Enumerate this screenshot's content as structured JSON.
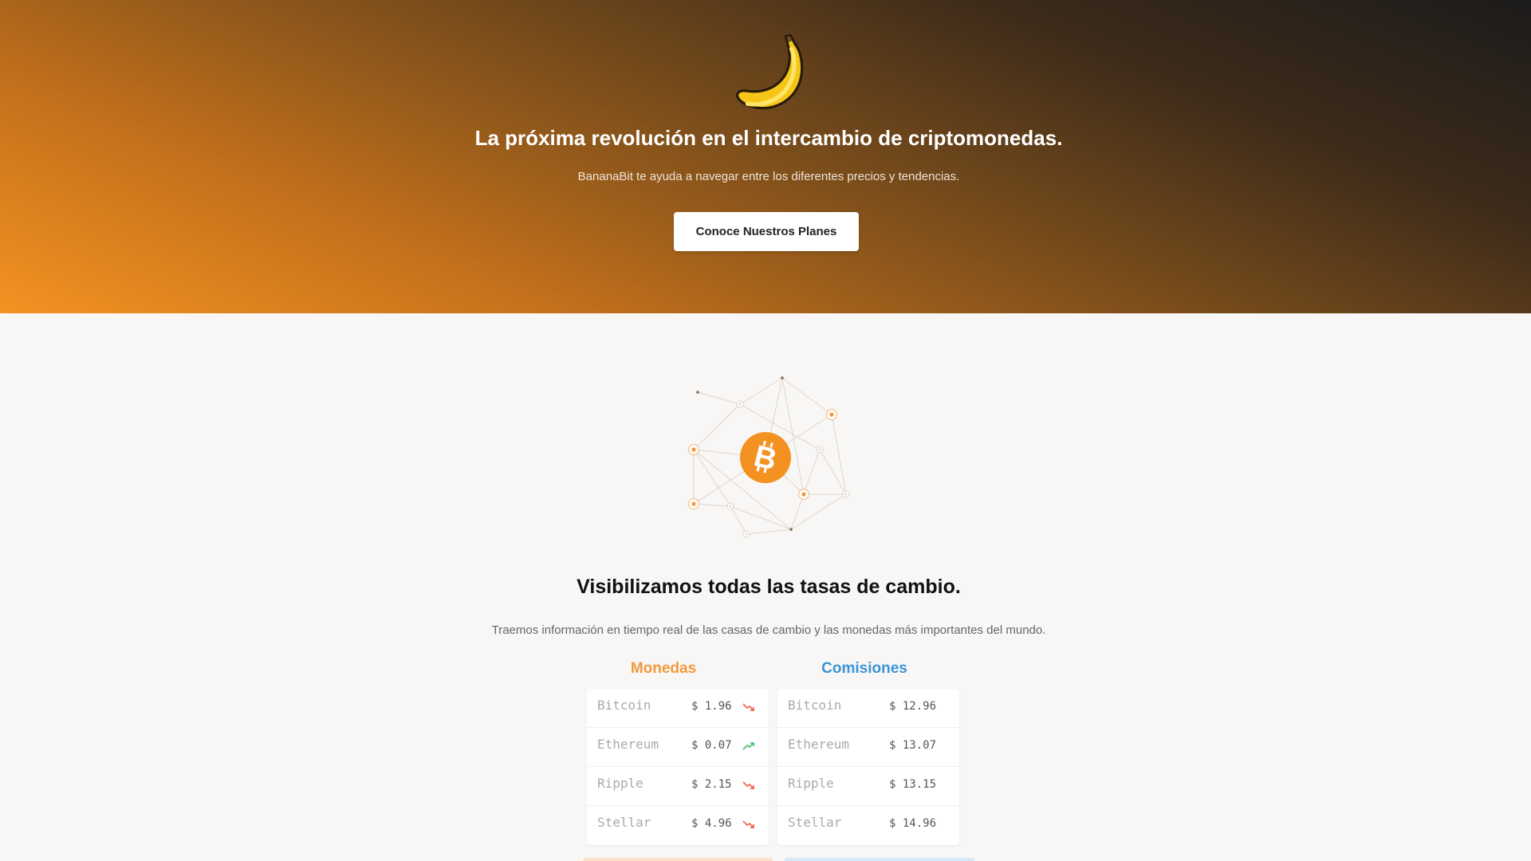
{
  "hero": {
    "title": "La próxima revolución en el intercambio de criptomonedas.",
    "subtitle": "BananaBit te ayuda a navegar entre los diferentes precios y tendencias.",
    "cta_label": "Conoce Nuestros Planes",
    "logo_icon": "banana-icon"
  },
  "section": {
    "icon": "bitcoin-icon",
    "title": "Visibilizamos todas las tasas de cambio.",
    "subtitle": "Traemos información en tiempo real de las casas de cambio y las monedas más importantes del mundo."
  },
  "monedas": {
    "title": "Monedas",
    "rows": [
      {
        "name": "Bitcoin",
        "price": "$ 1.96",
        "trend": "down"
      },
      {
        "name": "Ethereum",
        "price": "$ 0.07",
        "trend": "up"
      },
      {
        "name": "Ripple",
        "price": "$ 2.15",
        "trend": "down"
      },
      {
        "name": "Stellar",
        "price": "$ 4.96",
        "trend": "down"
      }
    ]
  },
  "comisiones": {
    "title": "Comisiones",
    "rows": [
      {
        "name": "Bitcoin",
        "price": "$ 12.96"
      },
      {
        "name": "Ethereum",
        "price": "$ 13.07"
      },
      {
        "name": "Ripple",
        "price": "$ 13.15"
      },
      {
        "name": "Stellar",
        "price": "$ 14.96"
      }
    ]
  },
  "colors": {
    "orange": "#f29a3c",
    "blue": "#3b95d6",
    "trend_up": "#4cc46b",
    "trend_down": "#ef6a4e"
  }
}
